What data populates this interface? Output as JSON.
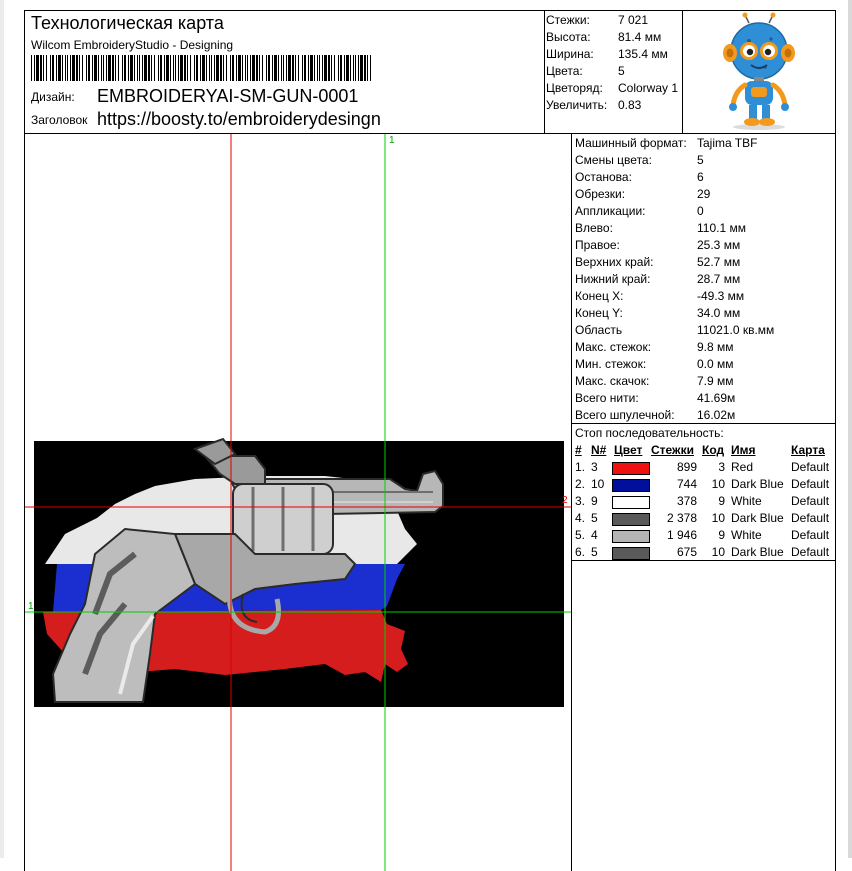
{
  "header": {
    "title": "Технологическая карта",
    "software": "Wilcom EmbroideryStudio - Designing",
    "design_label": "Дизайн:",
    "design_value": "EMBROIDERYAI-SM-GUN-0001",
    "heading_label": "Заголовок",
    "heading_value": "https://boosty.to/embroiderydesingn"
  },
  "summary": [
    {
      "label": "Стежки:",
      "value": "7 021"
    },
    {
      "label": "Высота:",
      "value": "81.4 мм"
    },
    {
      "label": "Ширина:",
      "value": "135.4 мм"
    },
    {
      "label": "Цвета:",
      "value": "5"
    },
    {
      "label": "Цветоряд:",
      "value": "Colorway 1"
    },
    {
      "label": "Увеличить:",
      "value": "0.83"
    }
  ],
  "properties": [
    {
      "label": "Машинный формат:",
      "value": "Tajima TBF"
    },
    {
      "label": "Смены цвета:",
      "value": "5"
    },
    {
      "label": "Останова:",
      "value": "6"
    },
    {
      "label": "Обрезки:",
      "value": "29"
    },
    {
      "label": "Аппликации:",
      "value": "0"
    },
    {
      "label": "Влево:",
      "value": "110.1 мм"
    },
    {
      "label": "Правое:",
      "value": "25.3 мм"
    },
    {
      "label": "Верхних край:",
      "value": "52.7 мм"
    },
    {
      "label": "Нижний край:",
      "value": "28.7 мм"
    },
    {
      "label": "Конец X:",
      "value": "-49.3 мм"
    },
    {
      "label": "Конец Y:",
      "value": "34.0 мм"
    },
    {
      "label": "Область",
      "value": "11021.0 кв.мм"
    },
    {
      "label": "Макс. стежок:",
      "value": "9.8 мм"
    },
    {
      "label": "Мин. стежок:",
      "value": "0.0 мм"
    },
    {
      "label": "Макс. скачок:",
      "value": "7.9 мм"
    },
    {
      "label": "Всего нити:",
      "value": "41.69м"
    },
    {
      "label": "Всего шпулечной:",
      "value": "16.02м"
    }
  ],
  "color_sequence": {
    "title": "Стоп последовательность:",
    "headers": {
      "num": "#",
      "n": "N#",
      "color": "Цвет",
      "stitches": "Стежки",
      "code": "Код",
      "name": "Имя",
      "chart": "Карта"
    },
    "rows": [
      {
        "num": "1.",
        "n": "3",
        "swatch": "#ee1111",
        "stitches": "899",
        "code": "3",
        "name": "Red",
        "chart": "Default"
      },
      {
        "num": "2.",
        "n": "10",
        "swatch": "#00109a",
        "stitches": "744",
        "code": "10",
        "name": "Dark Blue",
        "chart": "Default"
      },
      {
        "num": "3.",
        "n": "9",
        "swatch": "#ffffff",
        "stitches": "378",
        "code": "9",
        "name": "White",
        "chart": "Default"
      },
      {
        "num": "4.",
        "n": "5",
        "swatch": "#5a5a5a",
        "stitches": "2 378",
        "code": "10",
        "name": "Dark Blue",
        "chart": "Default"
      },
      {
        "num": "5.",
        "n": "4",
        "swatch": "#b4b4b4",
        "stitches": "1 946",
        "code": "9",
        "name": "White",
        "chart": "Default"
      },
      {
        "num": "6.",
        "n": "5",
        "swatch": "#5a5a5a",
        "stitches": "675",
        "code": "10",
        "name": "Dark Blue",
        "chart": "Default"
      }
    ]
  },
  "guides": {
    "v_green": "1",
    "h_red": "2",
    "h_green": "1"
  },
  "colors": {
    "guide_red": "#e00000",
    "guide_green": "#00d000",
    "canvas": "#000000"
  }
}
